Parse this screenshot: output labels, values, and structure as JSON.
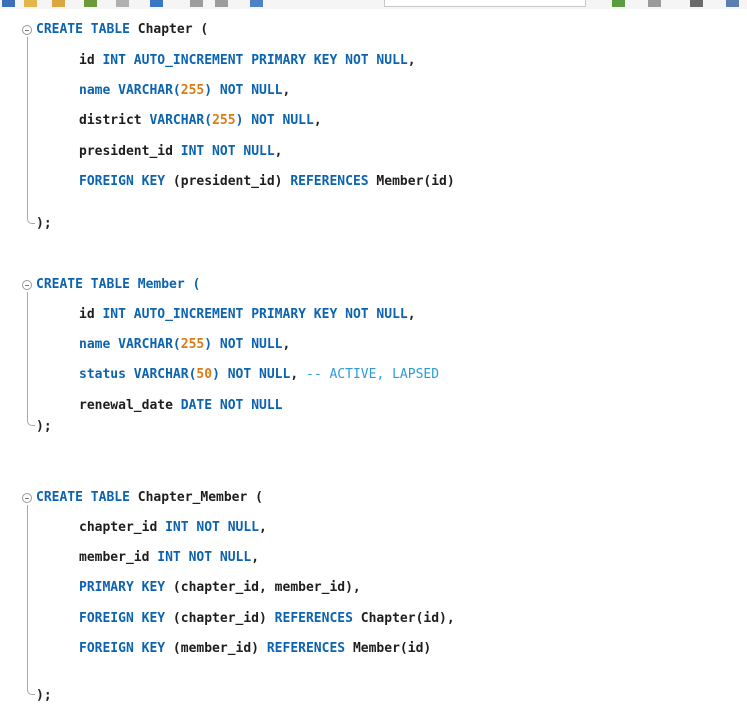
{
  "editor": {
    "blocks": [
      {
        "header": {
          "kw": "CREATE TABLE",
          "name": " Chapter ("
        },
        "lines": [
          {
            "a": "id ",
            "b": "INT AUTO_INCREMENT PRIMARY KEY NOT NULL",
            "c": ","
          },
          {
            "a": "name VARCHAR(",
            "b": "255",
            "c": ") ",
            "d": "NOT NULL",
            "e": ","
          },
          {
            "a": "district ",
            "b": "VARCHAR(",
            "c": "255",
            "d": ") NOT NULL",
            "e": ","
          },
          {
            "a": "president_id ",
            "b": "INT NOT NULL",
            "c": ","
          },
          {
            "a": "FOREIGN KEY",
            "b": " (president_id) ",
            "c": "REFERENCES",
            "d": " Member(id)"
          }
        ],
        "close": ");"
      },
      {
        "header": {
          "kw": "CREATE TABLE",
          "name": " Member ("
        },
        "lines": [
          {
            "a": "id ",
            "b": "INT AUTO_INCREMENT PRIMARY KEY NOT NULL",
            "c": ","
          },
          {
            "a": "name VARCHAR(",
            "b": "255",
            "c": ") ",
            "d": "NOT NULL",
            "e": ","
          },
          {
            "a": "status VARCHAR(",
            "b": "50",
            "c": ") NOT NULL",
            "d": ",",
            "e": " -- ACTIVE, LAPSED"
          },
          {
            "a": "renewal_date ",
            "b": "DATE NOT NULL"
          }
        ],
        "close": ");"
      },
      {
        "header": {
          "kw": "CREATE TABLE",
          "name": " Chapter_Member ("
        },
        "lines": [
          {
            "a": "chapter_id ",
            "b": "INT NOT NULL",
            "c": ","
          },
          {
            "a": "member_id ",
            "b": "INT NOT NULL",
            "c": ","
          },
          {
            "a": "PRIMARY KEY",
            "b": " (chapter_id, member_id),"
          },
          {
            "a": "FOREIGN KEY",
            "b": " (chapter_id) ",
            "c": "REFERENCES",
            "d": " Chapter(id),"
          },
          {
            "a": "FOREIGN KEY",
            "b": " (member_id) ",
            "c": "REFERENCES",
            "d": " Member(id)"
          }
        ],
        "close": ");"
      }
    ]
  },
  "colors": {
    "keyword": "#0c63b0",
    "number": "#d97b16",
    "comment": "#2e9bd6",
    "identifier": "#1e1e1e"
  },
  "toolbar": {
    "icons": [
      "save-icon",
      "open-icon",
      "edit-icon",
      "run-icon",
      "stop-icon",
      "chart-icon",
      "refresh-icon",
      "settings-icon",
      "format-icon",
      "zoom-icon",
      "export-icon",
      "import-icon",
      "window-icon"
    ]
  }
}
